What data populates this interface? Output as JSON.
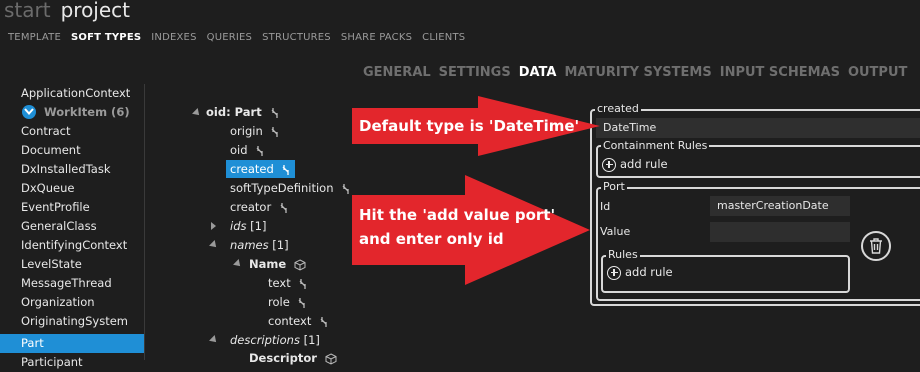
{
  "header": {
    "crumb_start": "start",
    "crumb_project": "project",
    "topnav": [
      "TEMPLATE",
      "SOFT TYPES",
      "INDEXES",
      "QUERIES",
      "STRUCTURES",
      "SHARE PACKS",
      "CLIENTS"
    ],
    "topnav_active": "SOFT TYPES",
    "subtabs": [
      "GENERAL",
      "SETTINGS",
      "DATA",
      "MATURITY SYSTEMS",
      "INPUT SCHEMAS",
      "OUTPUT"
    ],
    "subtab_active": "DATA"
  },
  "sidebar": {
    "items": [
      {
        "label": "ApplicationContext"
      },
      {
        "label": "WorkItem (6)",
        "group": true
      },
      {
        "label": "Contract"
      },
      {
        "label": "Document"
      },
      {
        "label": "DxInstalledTask"
      },
      {
        "label": "DxQueue"
      },
      {
        "label": "EventProfile"
      },
      {
        "label": "GeneralClass"
      },
      {
        "label": "IdentifyingContext"
      },
      {
        "label": "LevelState"
      },
      {
        "label": "MessageThread"
      },
      {
        "label": "Organization"
      },
      {
        "label": "OriginatingSystem"
      },
      {
        "label": "Part",
        "selected": true
      },
      {
        "label": "Participant"
      }
    ]
  },
  "tree": {
    "root": "oid:  Part",
    "nodes": [
      {
        "label": "origin"
      },
      {
        "label": "oid"
      },
      {
        "label": "created",
        "selected": true
      },
      {
        "label": "softTypeDefinition"
      },
      {
        "label": "creator"
      },
      {
        "label": "ids",
        "count": "[1]"
      },
      {
        "label": "names",
        "count": "[1]"
      },
      {
        "label": "Name"
      },
      {
        "label": "text"
      },
      {
        "label": "role"
      },
      {
        "label": "context"
      },
      {
        "label": "descriptions",
        "count": "[1]"
      },
      {
        "label": "Descriptor"
      }
    ]
  },
  "panel": {
    "created_title": "created",
    "created_value": "DateTime",
    "containment_title": "Containment Rules",
    "add_rule": "add rule",
    "port_title": "Port",
    "id_label": "Id",
    "id_value": "masterCreationDate",
    "value_label": "Value",
    "value_value": "",
    "rules_title": "Rules"
  },
  "callouts": {
    "one": "Default type is 'DateTime'",
    "two_line1": "Hit the 'add value port'",
    "two_line2": "and enter only id"
  },
  "colors": {
    "accent": "#1f8fd6",
    "callout_red": "#e3262c",
    "background": "#1e1e1e"
  }
}
